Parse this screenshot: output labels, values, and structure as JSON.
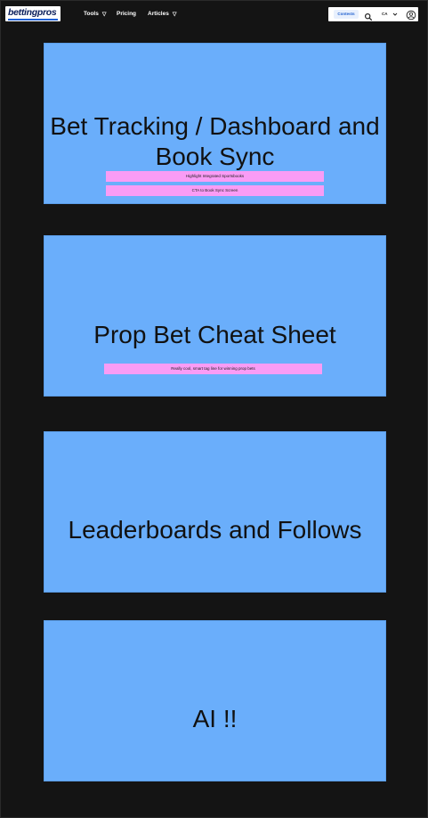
{
  "navbar": {
    "logo_text": "bettingpros",
    "links": [
      {
        "label": "Tools",
        "has_dropdown": true
      },
      {
        "label": "Pricing",
        "has_dropdown": false
      },
      {
        "label": "Articles",
        "has_dropdown": true
      }
    ],
    "dropdown_glyph": "▽",
    "contests_label": "Contests",
    "region_label": "CA",
    "icons": {
      "search": "search-icon",
      "region_dropdown": "chevron-down-icon",
      "account": "user-circle-icon"
    }
  },
  "cards": [
    {
      "title": "Bet Tracking / Dashboard and Book Sync",
      "buttons": [
        "Highlight Integrated Sportsbooks",
        "CTA to Book Sync Screen"
      ]
    },
    {
      "title": "Prop Bet Cheat Sheet",
      "buttons": [
        "Really cool, smart tag line for winning prop bets"
      ]
    },
    {
      "title": "Leaderboards and Follows",
      "buttons": []
    },
    {
      "title": "AI !!",
      "buttons": []
    }
  ],
  "colors": {
    "background": "#141414",
    "card": "#6aaefb",
    "pink_button": "#f99cf5",
    "logo_text": "#0b1f5c",
    "accent_blue": "#1f5fcf"
  }
}
